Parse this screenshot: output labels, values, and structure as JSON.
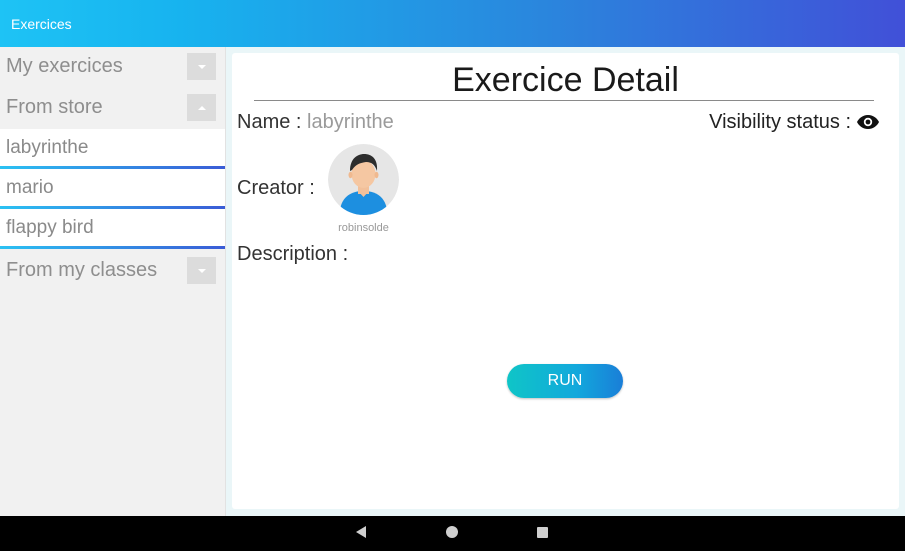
{
  "app": {
    "title": "Exercices"
  },
  "sidebar": {
    "sections": [
      {
        "label": "My exercices",
        "expanded": false
      },
      {
        "label": "From store",
        "expanded": true
      },
      {
        "label": "From my classes",
        "expanded": false
      }
    ],
    "store_items": [
      {
        "label": "labyrinthe",
        "selected": true
      },
      {
        "label": "mario",
        "selected": false
      },
      {
        "label": "flappy bird",
        "selected": false
      }
    ]
  },
  "detail": {
    "title": "Exercice Detail",
    "name_label": "Name : ",
    "name_value": "labyrinthe",
    "visibility_label": "Visibility status :",
    "visibility_icon": "eye-icon",
    "creator_label": "Creator :",
    "creator_name": "robinsolde",
    "description_label": "Description :",
    "run_label": "RUN"
  },
  "system_nav": {
    "back_icon": "back-triangle-icon",
    "home_icon": "home-circle-icon",
    "recents_icon": "recents-square-icon"
  },
  "colors": {
    "appbar_start": "#1ec3f5",
    "appbar_end": "#4150d8",
    "run_start": "#0fc5c7",
    "run_end": "#1a7ed8"
  }
}
